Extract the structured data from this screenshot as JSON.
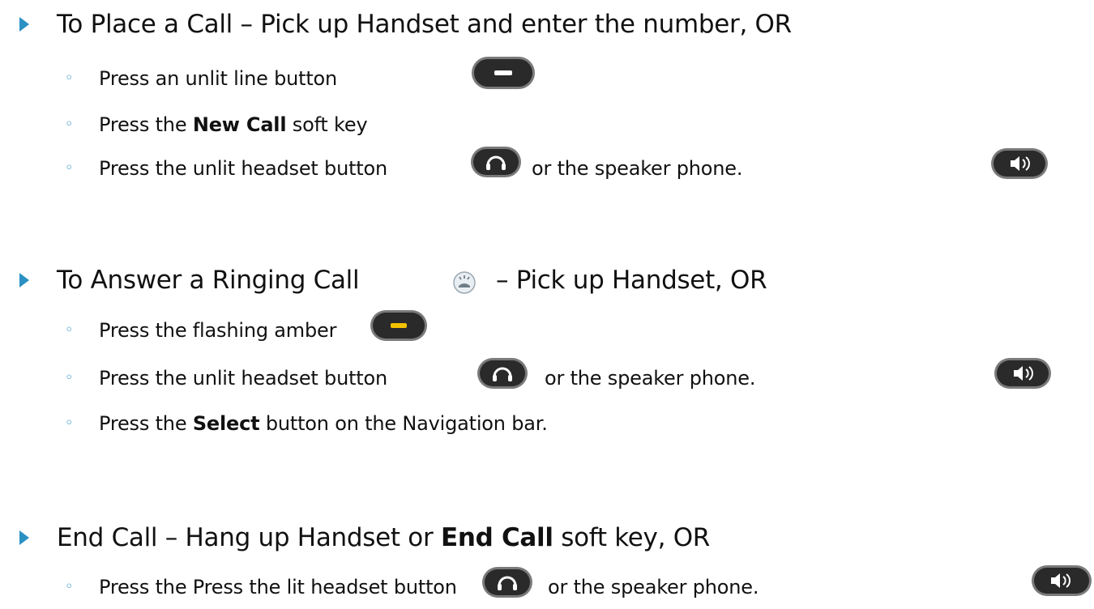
{
  "section1": {
    "heading": "To Place a Call – Pick up Handset and enter the number, OR",
    "items": [
      {
        "pre": "Press an unlit line button",
        "bold": "",
        "post": ""
      },
      {
        "pre": "Press the ",
        "bold": "New Call",
        "post": " soft key"
      },
      {
        "pre": "Press the unlit headset button",
        "bold": "",
        "post": "",
        "after": "or the speaker phone."
      }
    ]
  },
  "section2": {
    "heading_pre": "To Answer a Ringing Call",
    "heading_post": "– Pick up Handset, OR",
    "items": [
      {
        "pre": "Press the flashing amber",
        "bold": "",
        "post": ""
      },
      {
        "pre": "Press the unlit headset button",
        "bold": "",
        "post": "",
        "after": "or the speaker phone."
      },
      {
        "pre": "Press the ",
        "bold": "Select",
        "post": " button on the Navigation bar."
      }
    ]
  },
  "section3": {
    "heading_pre": "End Call – Hang up Handset or ",
    "heading_bold": "End Call",
    "heading_post": " soft key, OR",
    "items": [
      {
        "pre": "Press the Press the lit headset button",
        "bold": "",
        "post": "",
        "after": "or the speaker phone."
      }
    ]
  },
  "colors": {
    "bullet": "#2b91c3",
    "amber": "#f2c200",
    "button_body": "#2a2a2a"
  },
  "icons": [
    "line-button-icon",
    "headset-button-icon",
    "speaker-button-icon",
    "ringing-phone-icon",
    "amber-line-button-icon"
  ]
}
